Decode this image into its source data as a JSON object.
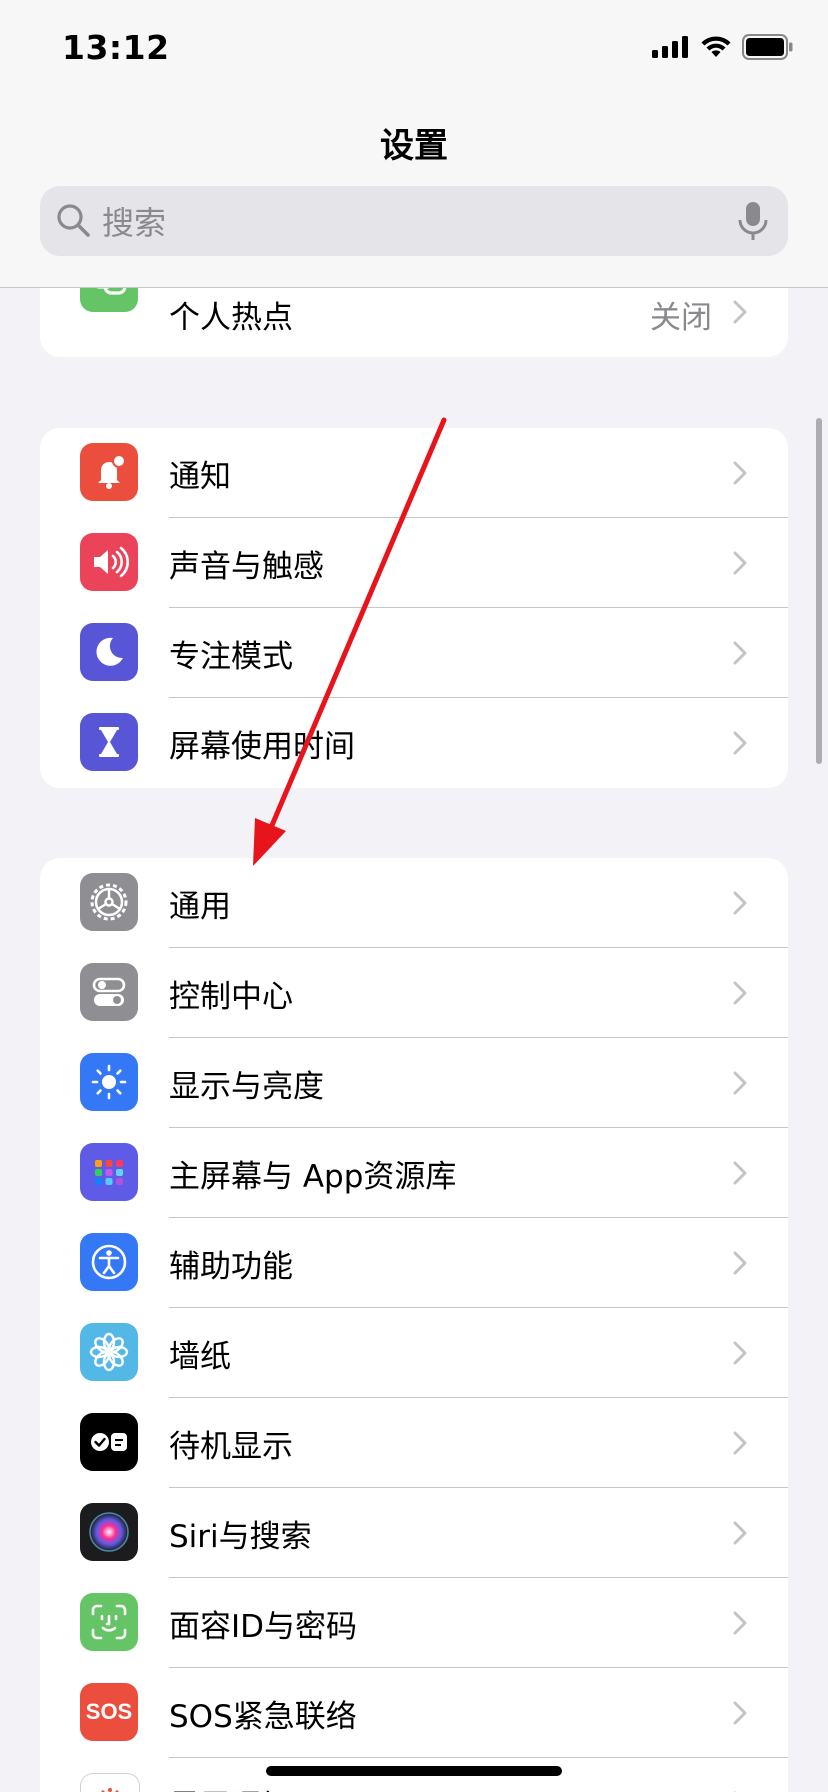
{
  "status_bar": {
    "time": "13:12"
  },
  "header": {
    "title": "设置"
  },
  "search": {
    "placeholder": "搜索"
  },
  "groups": [
    {
      "rows": [
        {
          "label": "个人热点",
          "value": "关闭",
          "icon": "hotspot-icon",
          "color": "#65C466"
        }
      ]
    },
    {
      "rows": [
        {
          "label": "通知",
          "icon": "bell-icon",
          "color": "#EB4E3D"
        },
        {
          "label": "声音与触感",
          "icon": "speaker-icon",
          "color": "#EB445A"
        },
        {
          "label": "专注模式",
          "icon": "moon-icon",
          "color": "#5856D6"
        },
        {
          "label": "屏幕使用时间",
          "icon": "hourglass-icon",
          "color": "#5856D6"
        }
      ]
    },
    {
      "rows": [
        {
          "label": "通用",
          "icon": "gear-icon",
          "color": "#8E8E93"
        },
        {
          "label": "控制中心",
          "icon": "toggles-icon",
          "color": "#8E8E93"
        },
        {
          "label": "显示与亮度",
          "icon": "sun-icon",
          "color": "#3478F6"
        },
        {
          "label": "主屏幕与 App资源库",
          "icon": "app-grid-icon",
          "color": "#5E5CE6"
        },
        {
          "label": "辅助功能",
          "icon": "accessibility-icon",
          "color": "#3478F6"
        },
        {
          "label": "墙纸",
          "icon": "flower-icon",
          "color": "#54B8E7"
        },
        {
          "label": "待机显示",
          "icon": "standby-icon",
          "color": "#000000"
        },
        {
          "label": "Siri与搜索",
          "icon": "siri-icon",
          "color": "#1C1C1E"
        },
        {
          "label": "面容ID与密码",
          "icon": "faceid-icon",
          "color": "#65C466"
        },
        {
          "label": "SOS紧急联络",
          "icon": "sos-icon",
          "color": "#EB4E3D"
        },
        {
          "label": "暴露通知",
          "icon": "exposure-icon",
          "color": "#FFFFFF"
        }
      ]
    }
  ],
  "sos_icon_text": "SOS"
}
